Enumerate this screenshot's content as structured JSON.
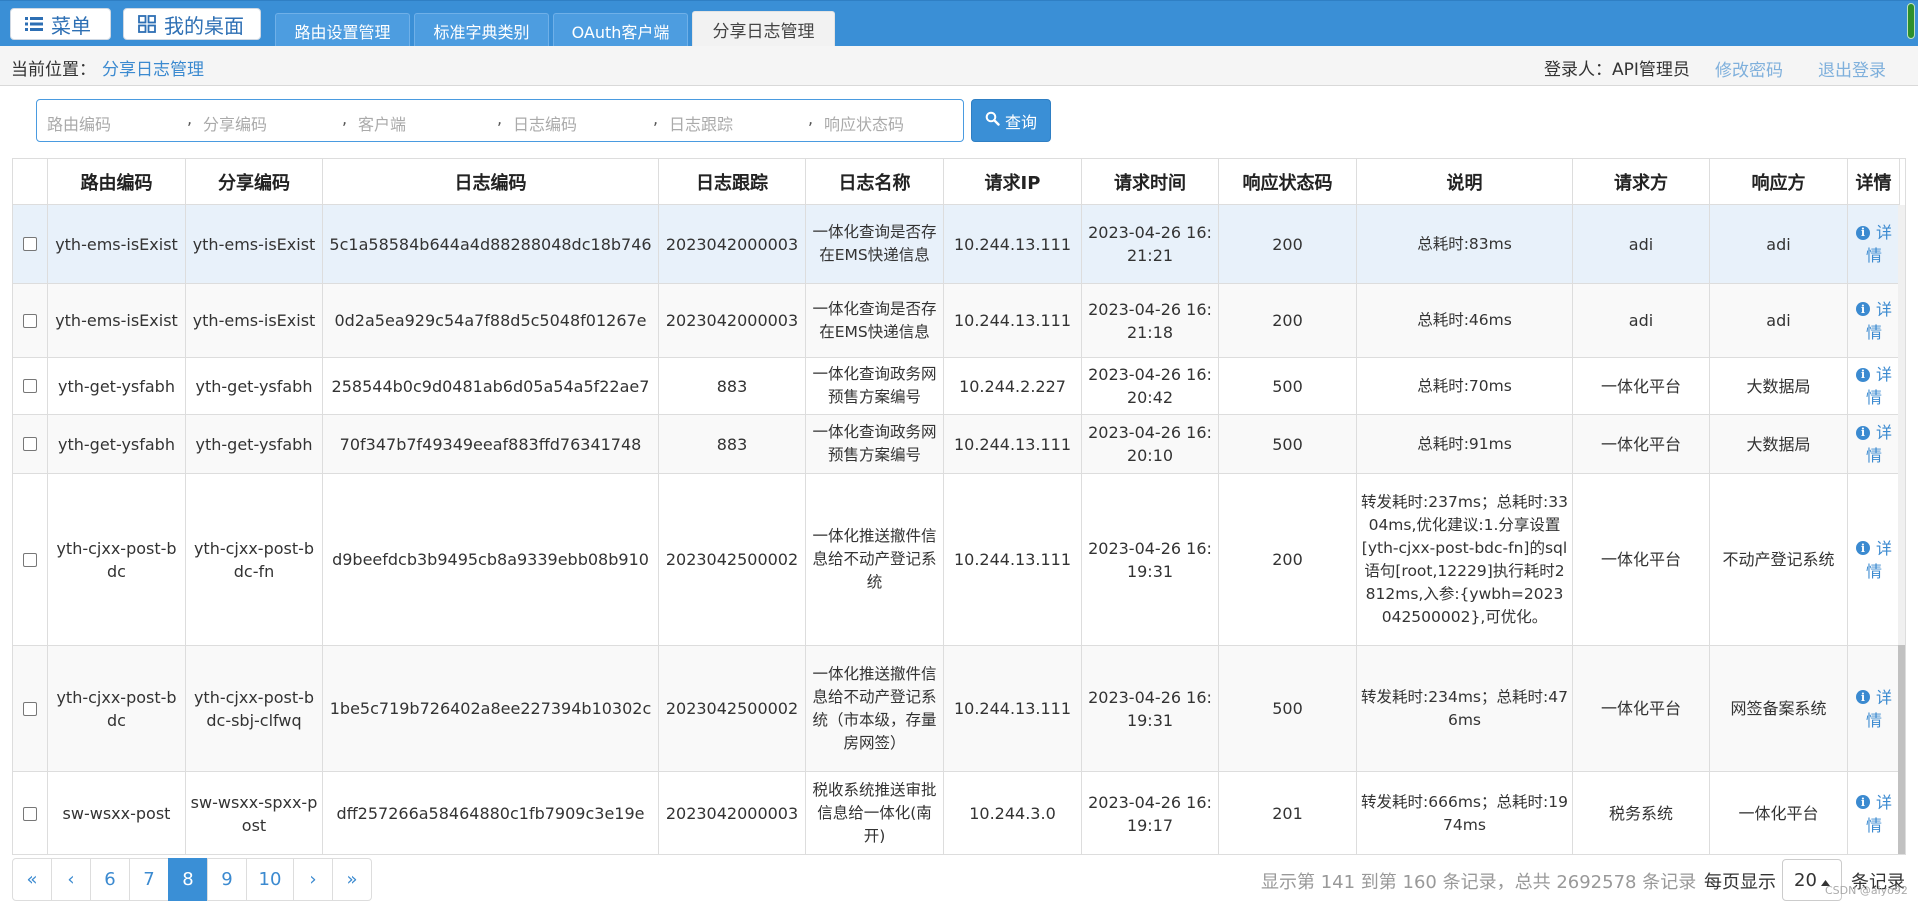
{
  "topbar": {
    "menu_label": "菜单",
    "desktop_label": "我的桌面",
    "tabs": [
      "路由设置管理",
      "标准字典类别",
      "OAuth客户端",
      "分享日志管理"
    ],
    "active_tab": 3
  },
  "breadcrumb": {
    "label": "当前位置：",
    "current": "分享日志管理",
    "login_label": "登录人：API管理员",
    "change_password": "修改密码",
    "logout": "退出登录"
  },
  "search": {
    "placeholders": [
      "路由编码",
      "分享编码",
      "客户端",
      "日志编码",
      "日志跟踪",
      "响应状态码"
    ],
    "separator": ",",
    "query_label": "查询"
  },
  "table": {
    "headers": [
      "路由编码",
      "分享编码",
      "日志编码",
      "日志跟踪",
      "日志名称",
      "请求IP",
      "请求时间",
      "响应状态码",
      "说明",
      "请求方",
      "响应方",
      "详情"
    ],
    "detail_label_1": "详",
    "detail_label_2": "情",
    "rows": [
      {
        "route": "yth-ems-isExist",
        "share": "yth-ems-isExist",
        "log": "5c1a58584b644a4d88288048dc18b746",
        "trace": "2023042000003",
        "name": "一体化查询是否存在EMS快递信息",
        "ip": "10.244.13.111",
        "time": "2023-04-26 16:21:21",
        "status": "200",
        "desc": "总耗时:83ms",
        "req": "adi",
        "resp": "adi"
      },
      {
        "route": "yth-ems-isExist",
        "share": "yth-ems-isExist",
        "log": "0d2a5ea929c54a7f88d5c5048f01267e",
        "trace": "2023042000003",
        "name": "一体化查询是否存在EMS快递信息",
        "ip": "10.244.13.111",
        "time": "2023-04-26 16:21:18",
        "status": "200",
        "desc": "总耗时:46ms",
        "req": "adi",
        "resp": "adi"
      },
      {
        "route": "yth-get-ysfabh",
        "share": "yth-get-ysfabh",
        "log": "258544b0c9d0481ab6d05a54a5f22ae7",
        "trace": "883",
        "name": "一体化查询政务网预售方案编号",
        "ip": "10.244.2.227",
        "time": "2023-04-26 16:20:42",
        "status": "500",
        "desc": "总耗时:70ms",
        "req": "一体化平台",
        "resp": "大数据局"
      },
      {
        "route": "yth-get-ysfabh",
        "share": "yth-get-ysfabh",
        "log": "70f347b7f49349eeaf883ffd76341748",
        "trace": "883",
        "name": "一体化查询政务网预售方案编号",
        "ip": "10.244.13.111",
        "time": "2023-04-26 16:20:10",
        "status": "500",
        "desc": "总耗时:91ms",
        "req": "一体化平台",
        "resp": "大数据局"
      },
      {
        "route": "yth-cjxx-post-bdc",
        "share": "yth-cjxx-post-bdc-fn",
        "log": "d9beefdcb3b9495cb8a9339ebb08b910",
        "trace": "2023042500002",
        "name": "一体化推送撤件信息给不动产登记系统",
        "ip": "10.244.13.111",
        "time": "2023-04-26 16:19:31",
        "status": "200",
        "desc": "转发耗时:237ms；总耗时:3304ms,优化建议:1.分享设置[yth-cjxx-post-bdc-fn]的sql语句[root,12229]执行耗时2812ms,入参:{ywbh=2023042500002},可优化。",
        "req": "一体化平台",
        "resp": "不动产登记系统"
      },
      {
        "route": "yth-cjxx-post-bdc",
        "share": "yth-cjxx-post-bdc-sbj-clfwq",
        "log": "1be5c719b726402a8ee227394b10302c",
        "trace": "2023042500002",
        "name": "一体化推送撤件信息给不动产登记系统（市本级，存量房网签）",
        "ip": "10.244.13.111",
        "time": "2023-04-26 16:19:31",
        "status": "500",
        "desc": "转发耗时:234ms；总耗时:476ms",
        "req": "一体化平台",
        "resp": "网签备案系统"
      },
      {
        "route": "sw-wsxx-post",
        "share": "sw-wsxx-spxx-post",
        "log": "dff257266a58464880c1fb7909c3e19e",
        "trace": "2023042000003",
        "name": "税收系统推送审批信息给一体化(南开)",
        "ip": "10.244.3.0",
        "time": "2023-04-26 16:19:17",
        "status": "201",
        "desc": "转发耗时:666ms；总耗时:1974ms",
        "req": "税务系统",
        "resp": "一体化平台"
      }
    ]
  },
  "pagination": {
    "first": "«",
    "prev": "‹",
    "pages": [
      "6",
      "7",
      "8",
      "9",
      "10"
    ],
    "active_page": "8",
    "next": "›",
    "last": "»",
    "summary": "显示第 141 到第 160 条记录，总共 2692578 条记录",
    "per_page_label": "每页显示",
    "page_size": "20",
    "records_label": "条记录"
  },
  "watermark": "CSDN @aiyo92",
  "colors": {
    "primary": "#3a8fd6",
    "link": "#3b8ad0",
    "selected_row": "#e8f1fa"
  }
}
